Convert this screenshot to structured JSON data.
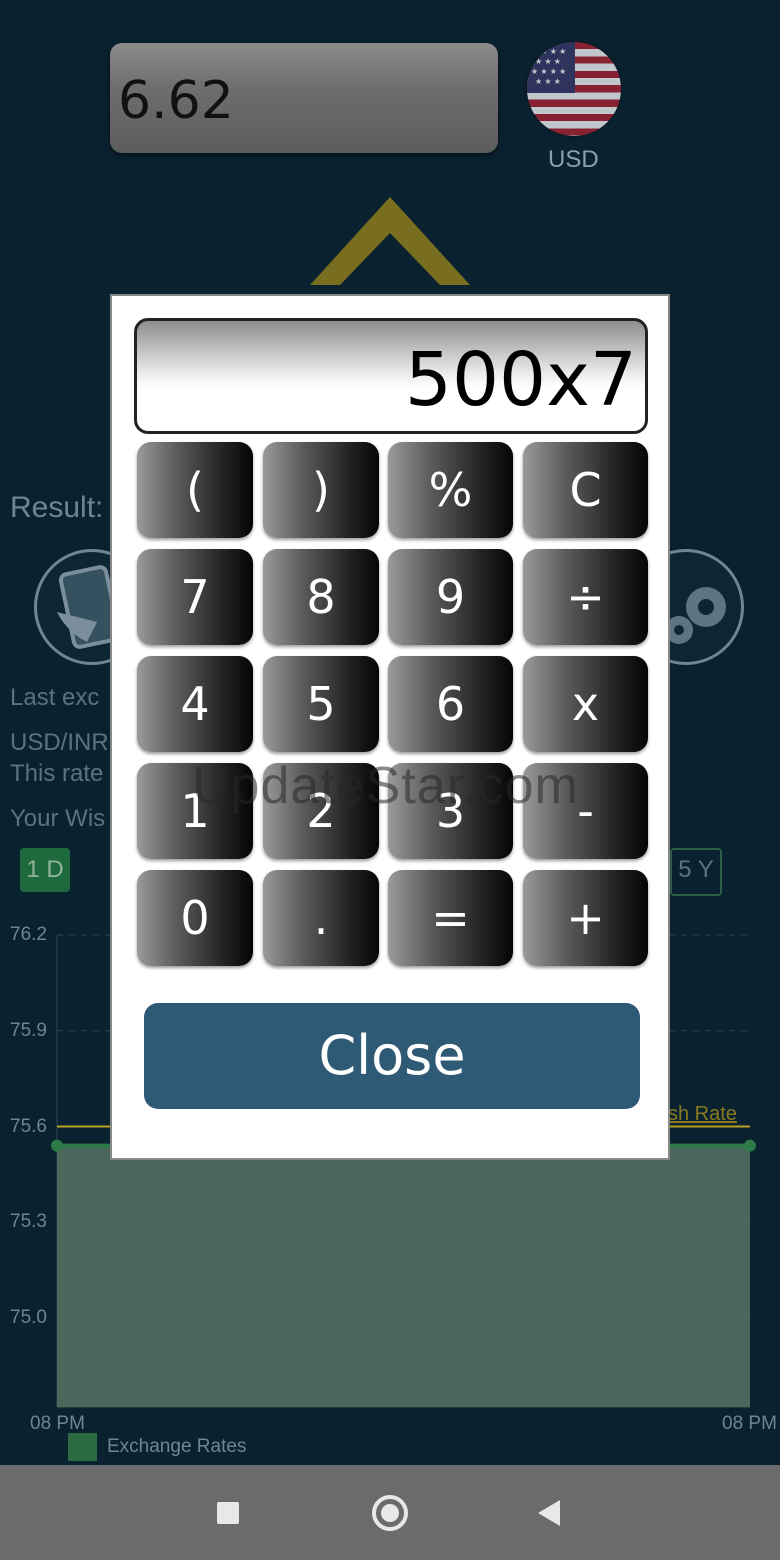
{
  "converter": {
    "amount": "6.62",
    "currency_code": "USD",
    "result_label": "Result:",
    "last_exchange_text": "Last exc",
    "pair_text": "USD/INR",
    "rate_note_text": "This rate",
    "wish_text": "Your Wis",
    "range_chips": [
      "1 D",
      "5 Y"
    ],
    "active_range": "1 D"
  },
  "chart": {
    "wish_rate_label": "sh Rate",
    "legend_label": "Exchange Rates",
    "colors": {
      "series": "#2c6a40",
      "wish_line": "#b8a020"
    }
  },
  "chart_data": {
    "type": "area",
    "x": [
      "08 PM",
      "08 PM"
    ],
    "series": [
      {
        "name": "Exchange Rates",
        "values": [
          75.54,
          75.54
        ]
      }
    ],
    "wish_rate": 75.6,
    "yticks": [
      "76.2",
      "75.9",
      "75.6",
      "75.3",
      "75.0"
    ],
    "ylim": [
      74.72,
      76.2
    ],
    "grid": true,
    "legend": "bottom-left"
  },
  "calculator": {
    "display": "500x7",
    "keys": [
      [
        "(",
        ")",
        "%",
        "C"
      ],
      [
        "7",
        "8",
        "9",
        "÷"
      ],
      [
        "4",
        "5",
        "6",
        "x"
      ],
      [
        "1",
        "2",
        "3",
        "-"
      ],
      [
        "0",
        ".",
        "=",
        "+"
      ]
    ],
    "close_label": "Close"
  },
  "watermark": "UpdateStar.com",
  "icons": [
    "us-flag-icon",
    "chevron-up-icon",
    "phone-shake-icon",
    "gears-icon",
    "square-nav-icon",
    "home-circle-icon",
    "back-triangle-icon"
  ]
}
